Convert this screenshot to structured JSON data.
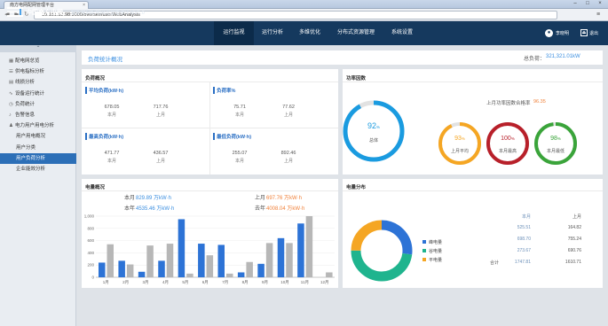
{
  "browser": {
    "tab_title": "南方电网配网管理平台",
    "url": "10.151.52.98:9000/oversee/userWebAnalysis"
  },
  "header": {
    "logo_text": "中国南方电网",
    "system_title": "智能电网配电网运营管理平台V1.0",
    "nav": [
      "运行监视",
      "运行分析",
      "多维优化",
      "分布式资源管理",
      "系统设置"
    ],
    "active_nav": 0,
    "user_name": "李晓明",
    "exit_label": "退出"
  },
  "sidebar": {
    "items": [
      {
        "label": "配电网总览",
        "icon": "grid-icon",
        "sub": false
      },
      {
        "label": "供电指标分析",
        "icon": "list-icon",
        "sub": false
      },
      {
        "label": "线损分析",
        "icon": "chart-icon",
        "sub": false
      },
      {
        "label": "设备运行统计",
        "icon": "pulse-icon",
        "sub": false
      },
      {
        "label": "负荷统计",
        "icon": "clock-icon",
        "sub": false
      },
      {
        "label": "告警信息",
        "icon": "bell-icon",
        "sub": false
      },
      {
        "label": "电力用户用电分析",
        "icon": "user-icon",
        "sub": false
      },
      {
        "label": "用户用电概况",
        "icon": "",
        "sub": true
      },
      {
        "label": "用户分类",
        "icon": "",
        "sub": true
      },
      {
        "label": "用户负荷分析",
        "icon": "",
        "sub": true,
        "active": true
      },
      {
        "label": "企业能效分析",
        "icon": "",
        "sub": true
      }
    ]
  },
  "breadcrumb": {
    "text": "负荷统计概况",
    "total_label": "总负荷：",
    "total_value": "321,321.01kW"
  },
  "load_panel": {
    "title": "负荷概况",
    "blocks": [
      {
        "title": "平均负荷(kW·h)",
        "values": [
          "678.05",
          "717.76"
        ],
        "labels": [
          "本月",
          "上月"
        ]
      },
      {
        "title": "负荷率%",
        "values": [
          "75.71",
          "77.62"
        ],
        "labels": [
          "本月",
          "上月"
        ]
      },
      {
        "title": "最高负荷(kW·h)",
        "values": [
          "471.77",
          "436.57"
        ],
        "labels": [
          "本月",
          "上月"
        ]
      },
      {
        "title": "最低负荷(kW·h)",
        "values": [
          "255.07",
          "892.46"
        ],
        "labels": [
          "本月",
          "上月"
        ]
      }
    ]
  },
  "index_panel": {
    "title": "功率因数",
    "remark_label": "上月功率因数合格率",
    "remark_value": "96.35",
    "gauges": [
      {
        "value": "92",
        "unit": "%",
        "label": "总体",
        "pct": 92,
        "color": "#1a9be0"
      },
      {
        "value": "93",
        "unit": "%",
        "label": "上月平均",
        "pct": 93,
        "color": "#f5a623"
      },
      {
        "value": "100",
        "unit": "%",
        "label": "本月最高",
        "pct": 100,
        "color": "#b8202a"
      },
      {
        "value": "98",
        "unit": "%",
        "label": "本月最低",
        "pct": 98,
        "color": "#3aa43a"
      }
    ]
  },
  "monthly_panel": {
    "title": "电量概况",
    "stats": [
      {
        "label": "本月",
        "value": "829.89 万kW·h",
        "color": "#3a8ee0"
      },
      {
        "label": "上月",
        "value": "697.76 万kW·h",
        "color": "#f0813a"
      },
      {
        "label": "本年",
        "value": "4535.46 万kW·h",
        "color": "#3a8ee0"
      },
      {
        "label": "去年",
        "value": "4008.04 万kW·h",
        "color": "#f0813a"
      }
    ]
  },
  "chart_data": {
    "type": "bar",
    "categories": [
      "1月",
      "2月",
      "3月",
      "4月",
      "5月",
      "6月",
      "7月",
      "8月",
      "9月",
      "10月",
      "11月",
      "12月"
    ],
    "ylim": [
      0,
      1000
    ],
    "yticks": [
      "0",
      "200",
      "400",
      "600",
      "800",
      "1,000"
    ],
    "series": [
      {
        "values": [
          240,
          270,
          90,
          270,
          950,
          550,
          530,
          80,
          220,
          640,
          880,
          0
        ],
        "color": "#2d73d6"
      },
      {
        "values": [
          540,
          210,
          520,
          550,
          60,
          360,
          60,
          250,
          560,
          560,
          1000,
          80
        ],
        "color": "#b7b7b7"
      }
    ]
  },
  "donut_panel": {
    "title": "电量分布",
    "slices": [
      {
        "name": "峰电量",
        "pct": 27,
        "color": "#2d73d6"
      },
      {
        "name": "谷电量",
        "pct": 48,
        "color": "#1fb48e"
      },
      {
        "name": "平电量",
        "pct": 25,
        "color": "#f5a623"
      }
    ],
    "table_headers": [
      "本月",
      "上月"
    ],
    "rows": [
      {
        "label": "",
        "a": "525.51",
        "b": "164.82"
      },
      {
        "label": "",
        "a": "698.70",
        "b": "755.24"
      },
      {
        "label": "",
        "a": "273.67",
        "b": "690.76"
      },
      {
        "label": "合计",
        "a": "1747.81",
        "b": "1610.71"
      }
    ]
  }
}
